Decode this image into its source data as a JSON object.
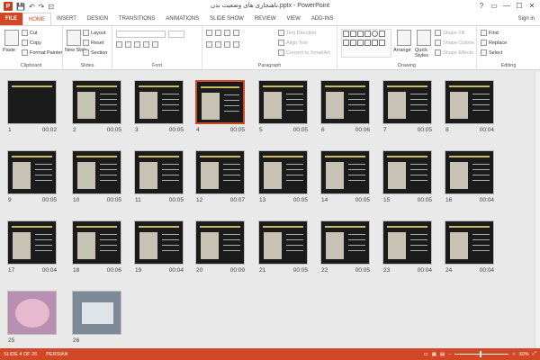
{
  "window": {
    "title": "ناهنجاری های وضعیت بدن.pptx - PowerPoint",
    "controls": [
      "?",
      "▭",
      "—",
      "☐",
      "✕"
    ]
  },
  "quick_access": {
    "logo": "P",
    "items": [
      "💾",
      "↶",
      "↷",
      "⊡"
    ]
  },
  "tabs": [
    "FILE",
    "HOME",
    "INSERT",
    "DESIGN",
    "TRANSITIONS",
    "ANIMATIONS",
    "SLIDE SHOW",
    "REVIEW",
    "VIEW",
    "ADD-INS"
  ],
  "active_tab": "HOME",
  "sign_in": "Sign in",
  "ribbon": {
    "clipboard": {
      "label": "Clipboard",
      "paste": "Paste",
      "cut": "Cut",
      "copy": "Copy",
      "format_painter": "Format Painter"
    },
    "slides": {
      "label": "Slides",
      "new_slide": "New Slide",
      "layout": "Layout",
      "reset": "Reset",
      "section": "Section"
    },
    "font": {
      "label": "Font"
    },
    "paragraph": {
      "label": "Paragraph",
      "text_direction": "Text Direction",
      "align_text": "Align Text",
      "convert_smartart": "Convert to SmartArt"
    },
    "drawing": {
      "label": "Drawing",
      "arrange": "Arrange",
      "quick_styles": "Quick Styles",
      "shape_fill": "Shape Fill",
      "shape_outline": "Shape Outline",
      "shape_effects": "Shape Effects"
    },
    "editing": {
      "label": "Editing",
      "find": "Find",
      "replace": "Replace",
      "select": "Select"
    }
  },
  "slides": [
    {
      "num": "1",
      "dur": "00:02"
    },
    {
      "num": "2",
      "dur": "00:05"
    },
    {
      "num": "3",
      "dur": "00:05"
    },
    {
      "num": "4",
      "dur": "00:05"
    },
    {
      "num": "5",
      "dur": "00:05"
    },
    {
      "num": "6",
      "dur": "00:06"
    },
    {
      "num": "7",
      "dur": "00:05"
    },
    {
      "num": "8",
      "dur": "00:04"
    },
    {
      "num": "9",
      "dur": "00:05"
    },
    {
      "num": "10",
      "dur": "00:05"
    },
    {
      "num": "11",
      "dur": "00:05"
    },
    {
      "num": "12",
      "dur": "00:07"
    },
    {
      "num": "13",
      "dur": "00:05"
    },
    {
      "num": "14",
      "dur": "00:05"
    },
    {
      "num": "15",
      "dur": "00:05"
    },
    {
      "num": "16",
      "dur": "00:04"
    },
    {
      "num": "17",
      "dur": "00:04"
    },
    {
      "num": "18",
      "dur": "00:06"
    },
    {
      "num": "19",
      "dur": "00:04"
    },
    {
      "num": "20",
      "dur": "00:09"
    },
    {
      "num": "21",
      "dur": "00:05"
    },
    {
      "num": "22",
      "dur": "00:05"
    },
    {
      "num": "23",
      "dur": "00:04"
    },
    {
      "num": "24",
      "dur": "00:04"
    },
    {
      "num": "25",
      "dur": ""
    },
    {
      "num": "26",
      "dur": ""
    }
  ],
  "selected_slide": "4",
  "status": {
    "slide": "SLIDE 4 OF 26",
    "language": "PERSIAN",
    "zoom": "50%"
  },
  "colors": {
    "accent": "#d24726",
    "slide_bg": "#1b1b1b"
  }
}
